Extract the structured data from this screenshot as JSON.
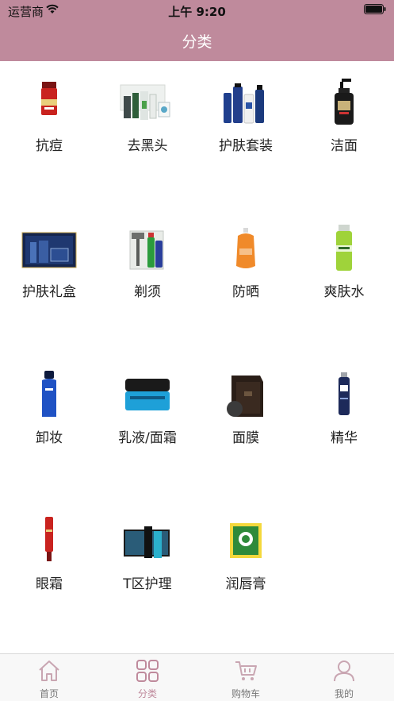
{
  "status_bar": {
    "carrier": "运营商",
    "time": "上午 9:20"
  },
  "nav": {
    "title": "分类"
  },
  "categories": [
    {
      "label": "抗痘",
      "icon": "red-bottle-product-icon"
    },
    {
      "label": "去黑头",
      "icon": "skincare-set-product-icon"
    },
    {
      "label": "护肤套装",
      "icon": "blue-bottles-product-icon"
    },
    {
      "label": "洁面",
      "icon": "pump-bottle-product-icon"
    },
    {
      "label": "护肤礼盒",
      "icon": "gift-box-product-icon"
    },
    {
      "label": "剃须",
      "icon": "razor-product-icon"
    },
    {
      "label": "防晒",
      "icon": "sunscreen-product-icon"
    },
    {
      "label": "爽肤水",
      "icon": "green-toner-product-icon"
    },
    {
      "label": "卸妆",
      "icon": "blue-bottle-product-icon"
    },
    {
      "label": "乳液/面霜",
      "icon": "cream-jar-product-icon"
    },
    {
      "label": "面膜",
      "icon": "mask-box-product-icon"
    },
    {
      "label": "精华",
      "icon": "serum-product-icon"
    },
    {
      "label": "眼霜",
      "icon": "eye-cream-product-icon"
    },
    {
      "label": "T区护理",
      "icon": "t-zone-set-product-icon"
    },
    {
      "label": "润唇膏",
      "icon": "lip-balm-product-icon"
    }
  ],
  "tabbar": {
    "active_color": "#bf8a9c",
    "inactive_color": "#c9a6b2",
    "tabs": [
      {
        "label": "首页",
        "icon": "home-icon"
      },
      {
        "label": "分类",
        "icon": "category-grid-icon",
        "active": true
      },
      {
        "label": "购物车",
        "icon": "cart-icon"
      },
      {
        "label": "我的",
        "icon": "user-icon"
      }
    ]
  }
}
